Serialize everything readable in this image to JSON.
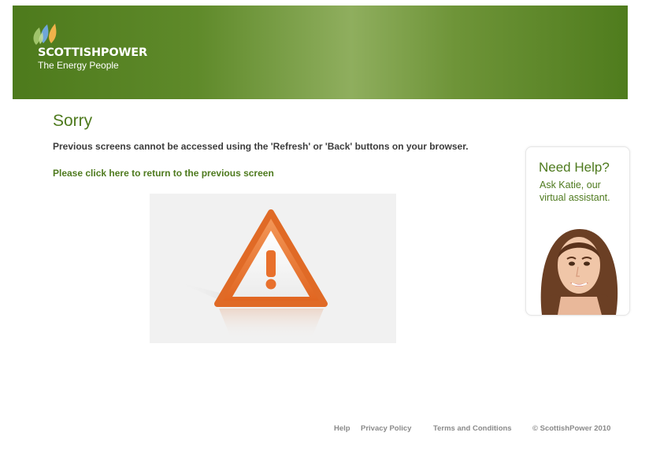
{
  "header": {
    "brand": "SCOTTISHPOWER",
    "tagline": "The Energy People"
  },
  "error": {
    "title": "Sorry",
    "message": "Previous screens cannot be accessed using the 'Refresh' or 'Back' buttons on your browser.",
    "return_link": "Please click here to return to the previous screen",
    "icon": "warning-triangle-icon"
  },
  "help_widget": {
    "title": "Need Help?",
    "subtitle": "Ask Katie, our virtual assistant."
  },
  "footer": {
    "links": [
      "Help",
      "Privacy Policy",
      "Terms and Conditions"
    ],
    "copyright": "© ScottishPower 2010"
  },
  "colors": {
    "brand_green": "#4e7a1e",
    "warning_orange": "#e8702c",
    "footer_gray": "#8a8a8a"
  }
}
